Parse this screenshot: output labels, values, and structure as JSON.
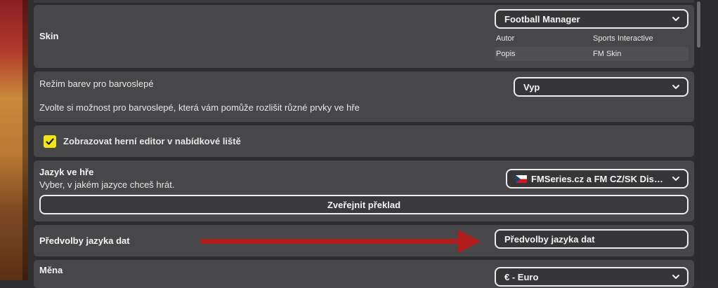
{
  "skin": {
    "label": "Skin",
    "selected": "Football Manager",
    "author_label": "Autor",
    "author_value": "Sports Interactive",
    "description_label": "Popis",
    "description_value": "FM Skin"
  },
  "colorblind": {
    "label": "Režim barev pro barvoslepé",
    "description": "Zvolte si možnost pro barvoslepé, která vám pomůže rozlišit různé prvky ve hře",
    "selected": "Vyp"
  },
  "editor_toggle": {
    "label": "Zobrazovat herní editor v nabídkové liště",
    "checked": true
  },
  "language": {
    "label": "Jazyk ve hře",
    "description": "Vyber, v jakém jazyce chceš hrát.",
    "selected": "FMSeries.cz a FM CZ/SK Disco...",
    "publish_button": "Zveřejnit překlad"
  },
  "data_language": {
    "label": "Předvolby jazyka dat",
    "button": "Předvolby jazyka dat"
  },
  "currency": {
    "label": "Měna",
    "selected": "€ - Euro"
  },
  "colors": {
    "accent_checkbox": "#f1e419",
    "annotation_arrow": "#b01c1c"
  }
}
